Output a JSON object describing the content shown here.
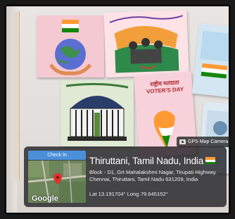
{
  "camera_tag": {
    "label": "GPS Map Camera",
    "icon": "camera-icon"
  },
  "checkin": {
    "label": "Check In"
  },
  "map": {
    "brand": "Google"
  },
  "location": {
    "title": "Thiruttani, Tamil Nadu, India",
    "address": "Block - D1, Grt Mahalakshmi Nagar, Tirupati Highway, Chennai, Thiruttani, Tamil Nadu 631209, India",
    "latlong": "Lat 13.191704° Long 79.645152°"
  },
  "posters": {
    "voters_day": "राष्ट्रीय मतदाता VOTER'S DAY"
  },
  "colors": {
    "checkin_blue": "#4a90d9",
    "saffron": "#ff9933",
    "green": "#138808"
  }
}
